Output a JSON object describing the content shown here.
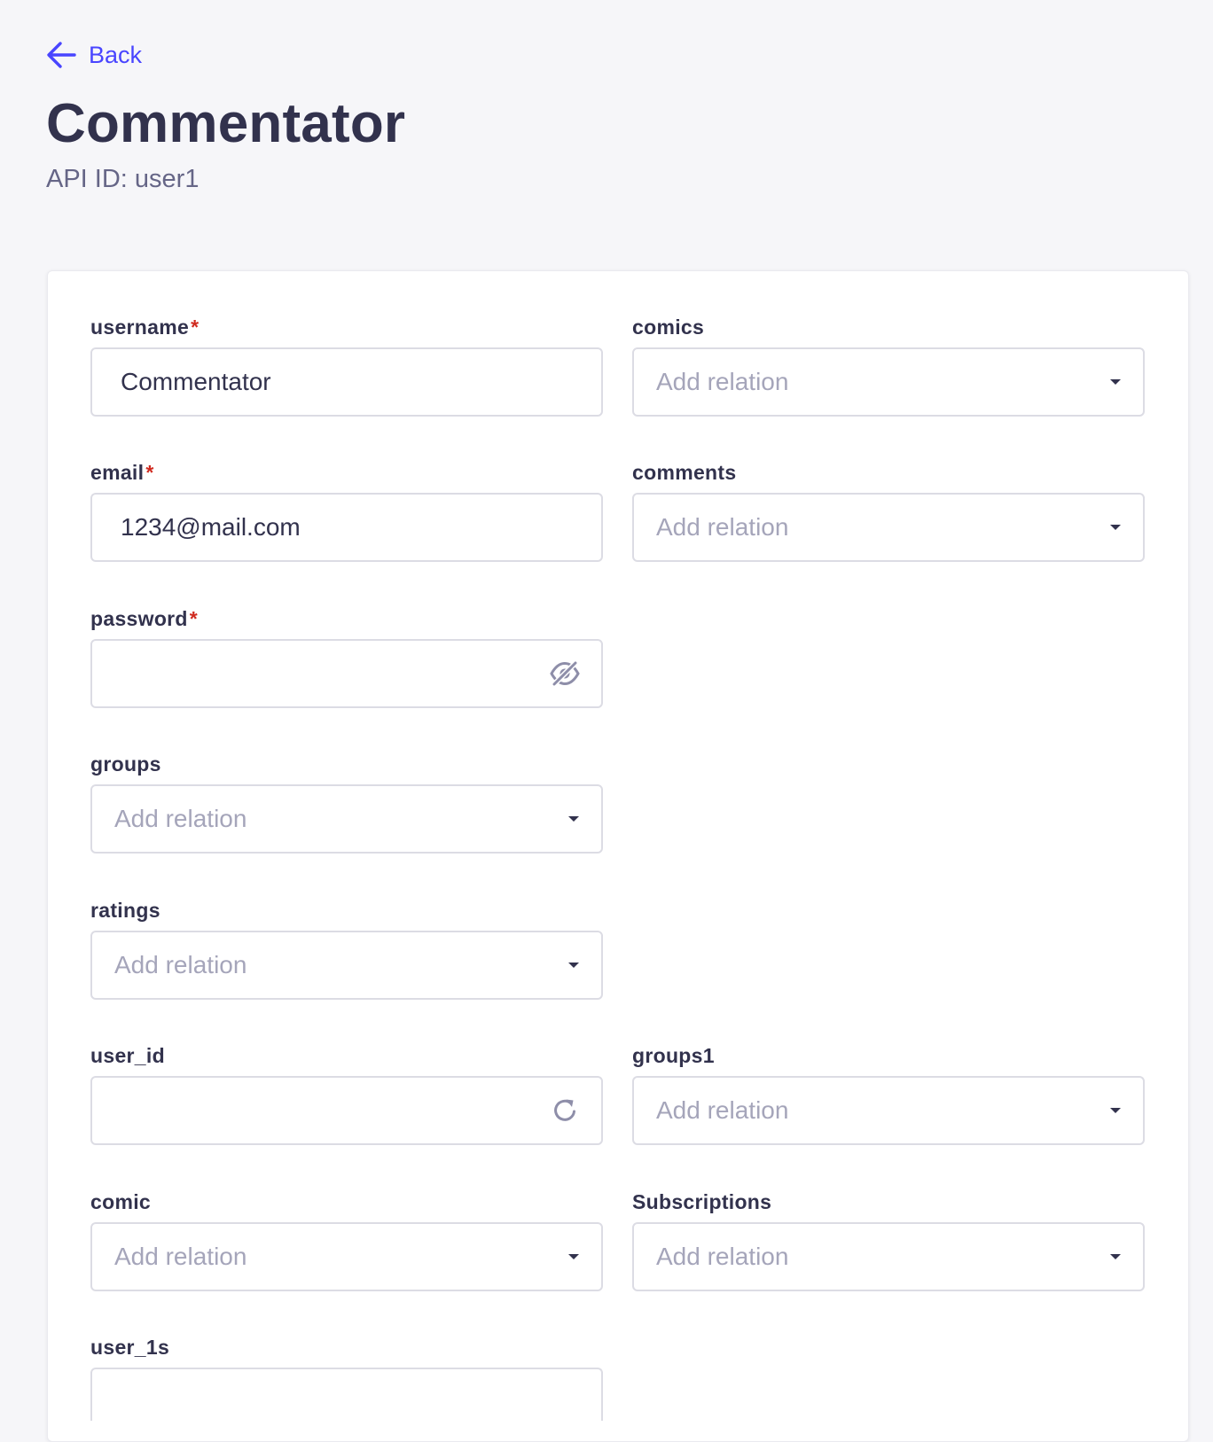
{
  "header": {
    "back_label": "Back",
    "title": "Commentator",
    "api_id": "API ID: user1"
  },
  "form": {
    "username": {
      "label": "username",
      "required_mark": "*",
      "value": "Commentator"
    },
    "email": {
      "label": "email",
      "required_mark": "*",
      "value": "1234@mail.com"
    },
    "password": {
      "label": "password",
      "required_mark": "*",
      "value": "",
      "icon": "eye-off-icon"
    },
    "groups": {
      "label": "groups",
      "placeholder": "Add relation"
    },
    "ratings": {
      "label": "ratings",
      "placeholder": "Add relation"
    },
    "user_id": {
      "label": "user_id",
      "value": "",
      "icon": "refresh-icon"
    },
    "comic": {
      "label": "comic",
      "placeholder": "Add relation"
    },
    "user_1s": {
      "label": "user_1s"
    },
    "comics": {
      "label": "comics",
      "placeholder": "Add relation"
    },
    "comments": {
      "label": "comments",
      "placeholder": "Add relation"
    },
    "groups1": {
      "label": "groups1",
      "placeholder": "Add relation"
    },
    "subscriptions": {
      "label": "Subscriptions",
      "placeholder": "Add relation"
    }
  },
  "colors": {
    "accent": "#4945ff",
    "text": "#32324d",
    "subtle_text": "#666687",
    "placeholder": "#a5a5ba",
    "required": "#d02b20",
    "border": "#dcdce4",
    "background": "#f6f6f9"
  }
}
